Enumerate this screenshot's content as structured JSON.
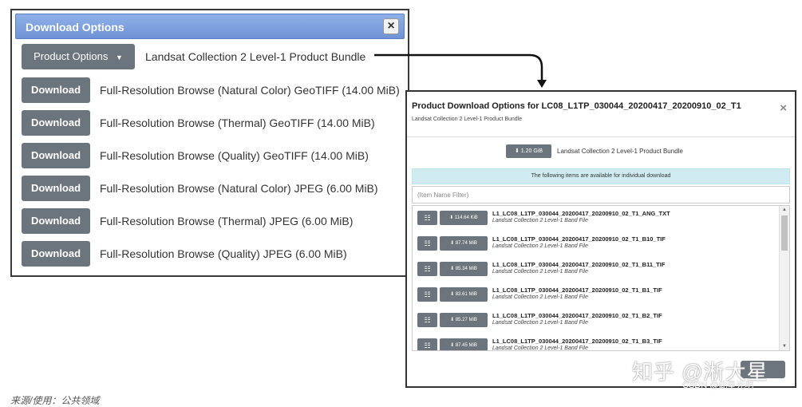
{
  "dialog1": {
    "title": "Download Options",
    "close_icon": "×",
    "product_options_label": "Product Options",
    "bundle_label": "Landsat Collection 2 Level-1 Product Bundle",
    "rows": [
      {
        "button": "Download",
        "label": "Full-Resolution Browse (Natural Color) GeoTIFF (14.00 MiB)"
      },
      {
        "button": "Download",
        "label": "Full-Resolution Browse (Thermal) GeoTIFF (14.00 MiB)"
      },
      {
        "button": "Download",
        "label": "Full-Resolution Browse (Quality) GeoTIFF (14.00 MiB)"
      },
      {
        "button": "Download",
        "label": "Full-Resolution Browse (Natural Color) JPEG (6.00 MiB)"
      },
      {
        "button": "Download",
        "label": "Full-Resolution Browse (Thermal) JPEG (6.00 MiB)"
      },
      {
        "button": "Download",
        "label": "Full-Resolution Browse (Quality) JPEG (6.00 MiB)"
      }
    ]
  },
  "dialog2": {
    "title": "Product Download Options for LC08_L1TP_030044_20200417_20200910_02_T1",
    "subtitle": "Landsat Collection 2 Level-1 Product Bundle",
    "close_icon": "×",
    "bundle_size": "1.20 GiB",
    "bundle_label": "Landsat Collection 2 Level-1 Product Bundle",
    "info_text": "The following items are available for individual download",
    "filter_placeholder": "(Item Name Filter)",
    "files": [
      {
        "size": "114.64 KiB",
        "name": "L1_LC08_L1TP_030044_20200417_20200910_02_T1_ANG_TXT",
        "type": "Landsat Collection 2 Level-1 Band File"
      },
      {
        "size": "87.74 MiB",
        "name": "L1_LC08_L1TP_030044_20200417_20200910_02_T1_B10_TIF",
        "type": "Landsat Collection 2 Level-1 Band File"
      },
      {
        "size": "85.34 MiB",
        "name": "L1_LC08_L1TP_030044_20200417_20200910_02_T1_B11_TIF",
        "type": "Landsat Collection 2 Level-1 Band File"
      },
      {
        "size": "83.61 MiB",
        "name": "L1_LC08_L1TP_030044_20200417_20200910_02_T1_B1_TIF",
        "type": "Landsat Collection 2 Level-1 Band File"
      },
      {
        "size": "85.27 MiB",
        "name": "L1_LC08_L1TP_030044_20200417_20200910_02_T1_B2_TIF",
        "type": "Landsat Collection 2 Level-1 Band File"
      },
      {
        "size": "87.45 MiB",
        "name": "L1_LC08_L1TP_030044_20200417_20200910_02_T1_B3_TIF",
        "type": "Landsat Collection 2 Level-1 Band File"
      }
    ]
  },
  "icons": {
    "cart": "shopping-cart-icon",
    "download": "download-icon",
    "caret": "caret-down-icon"
  },
  "watermark": "知乎 @淅大星",
  "credit": "CSDN @此星光明",
  "caption": "来源/使用：公共领域",
  "colors": {
    "header_blue": "#7a9ee0",
    "button_gray": "#6c757d",
    "info_bg": "#d1ecf1"
  }
}
